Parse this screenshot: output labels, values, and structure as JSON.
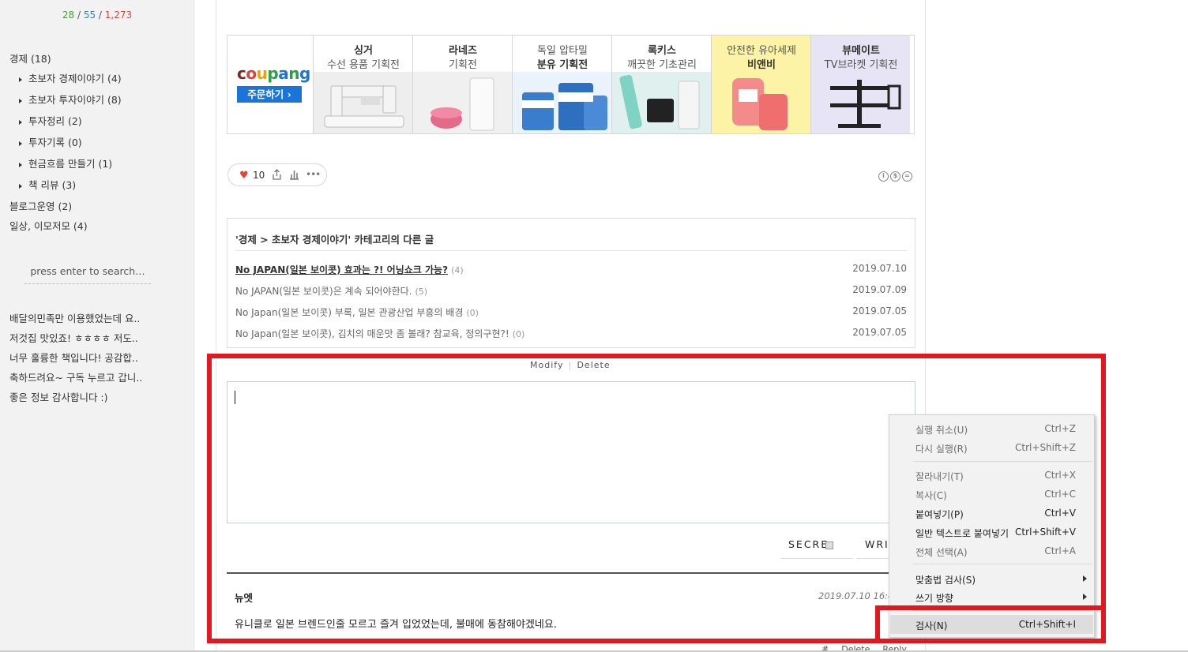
{
  "sidebar": {
    "counter": {
      "today": "28",
      "yesterday": "55",
      "total": "1,273",
      "sep": "/"
    },
    "categories": [
      {
        "label": "경제 (18)",
        "level": 0
      },
      {
        "label": "초보자 경제이야기 (4)",
        "level": 1
      },
      {
        "label": "초보자 투자이야기 (8)",
        "level": 1
      },
      {
        "label": "투자정리 (2)",
        "level": 1
      },
      {
        "label": "투자기록 (0)",
        "level": 1
      },
      {
        "label": "현금흐름 만들기 (1)",
        "level": 1
      },
      {
        "label": "책 리뷰 (3)",
        "level": 1
      },
      {
        "label": "블로그운영 (2)",
        "level": 0
      },
      {
        "label": "일상, 이모저모 (4)",
        "level": 0
      }
    ],
    "search_placeholder": "press enter to search…",
    "recent_comments": [
      "배달의민족만 이용했었는데 요..",
      "저것집 맛있죠! ㅎㅎㅎㅎ 저도..",
      "너무 훌륭한 책입니다! 공감합..",
      "축하드려요~ 구독 누르고 갑니..",
      "좋은 정보 감사합니다 :)"
    ]
  },
  "ad": {
    "brand": "coupang",
    "order_button": "주문하기 ›",
    "tiles": [
      {
        "line1": "싱거",
        "line2": "수선 용품 기획전"
      },
      {
        "line1": "라네즈",
        "line2": "기획전"
      },
      {
        "line1": "독일 압타밀",
        "line2": "분유 기획전"
      },
      {
        "line1": "록키스",
        "line2": "깨끗한 기초관리"
      },
      {
        "line1": "안전한 유아세제",
        "line2": "비앤비"
      },
      {
        "line1": "뷰메이트",
        "line2": "TV브라켓 기획전"
      }
    ]
  },
  "reactions": {
    "like_count": "10",
    "more": "•••"
  },
  "related": {
    "title": "'경제 > 초보자 경제이야기' 카테고리의 다른 글",
    "posts": [
      {
        "title": "No JAPAN(일본 보이콧) 효과는 ?! 어닝쇼크 가능?",
        "count": "(4)",
        "date": "2019.07.10"
      },
      {
        "title": "No JAPAN(일본 보이콧)은 계속 되어야한다.",
        "count": "(5)",
        "date": "2019.07.09"
      },
      {
        "title": "No Japan(일본 보이콧) 부록, 일본 관광산업 부흥의 배경",
        "count": "(0)",
        "date": "2019.07.05"
      },
      {
        "title": "No Japan(일본 보이콧), 김치의 매운맛 좀 볼래? 참교육, 정의구현?!",
        "count": "(0)",
        "date": "2019.07.05"
      }
    ]
  },
  "post_actions": {
    "modify": "Modify",
    "delete": "Delete"
  },
  "comment_form": {
    "secret_label": "SECRE",
    "write_label": "WRI"
  },
  "comment": {
    "author": "뉴엣",
    "date": "2019.07.10 16:46",
    "text": "유니클로 일본 브렌드인줄 모르고 즐겨 입었었는데, 불매에 동참해야겠네요.",
    "actions": [
      "#",
      "Delete",
      "Reply"
    ]
  },
  "context_menu": {
    "items": [
      {
        "label": "실행 취소(U)",
        "shortcut": "Ctrl+Z",
        "enabled": false
      },
      {
        "label": "다시 실행(R)",
        "shortcut": "Ctrl+Shift+Z",
        "enabled": false
      },
      {
        "label": "잘라내기(T)",
        "shortcut": "Ctrl+X",
        "enabled": false
      },
      {
        "label": "복사(C)",
        "shortcut": "Ctrl+C",
        "enabled": false
      },
      {
        "label": "붙여넣기(P)",
        "shortcut": "Ctrl+V",
        "enabled": true
      },
      {
        "label": "일반 텍스트로 붙여넣기",
        "shortcut": "Ctrl+Shift+V",
        "enabled": true
      },
      {
        "label": "전체 선택(A)",
        "shortcut": "Ctrl+A",
        "enabled": false
      },
      {
        "label": "맞춤법 검사(S)",
        "shortcut": "",
        "enabled": true,
        "submenu": true
      },
      {
        "label": "쓰기 방향",
        "shortcut": "",
        "enabled": true,
        "submenu": true
      },
      {
        "label": "검사(N)",
        "shortcut": "Ctrl+Shift+I",
        "enabled": true,
        "highlighted": true
      }
    ]
  },
  "colors": {
    "highlight_box": "#e0181f",
    "coupang_blue": "#1a74d9",
    "like_heart": "#e0443d"
  }
}
